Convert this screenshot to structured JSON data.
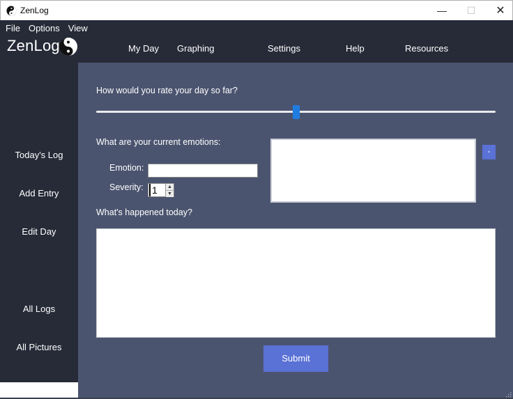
{
  "window": {
    "title": "ZenLog",
    "minimize_glyph": "—",
    "maximize_glyph": "☐",
    "close_glyph": "✕"
  },
  "menubar": {
    "items": [
      "File",
      "Options",
      "View"
    ]
  },
  "brand": {
    "name": "ZenLog",
    "logo_icon": "yin-yang-icon"
  },
  "topnav": {
    "items": [
      "My Day",
      "Graphing",
      "Settings",
      "Help",
      "Resources"
    ]
  },
  "sidebar": {
    "items": [
      "Today's Log",
      "Add Entry",
      "Edit Day",
      "All Logs",
      "All Pictures"
    ]
  },
  "main": {
    "rating_question": "How would you rate your day so far?",
    "rating_value": 0.5,
    "emotions_question": "What are your current emotions:",
    "emotion_label": "Emotion:",
    "emotion_value": "",
    "severity_label": "Severity:",
    "severity_value": "1",
    "remove_label": "-",
    "happened_question": "What's happened today?",
    "happened_value": "",
    "submit_label": "Submit"
  },
  "colors": {
    "header_bg": "#272b38",
    "main_bg": "#4b546f",
    "accent": "#5a71d6",
    "slider_thumb": "#1f7ce0"
  }
}
